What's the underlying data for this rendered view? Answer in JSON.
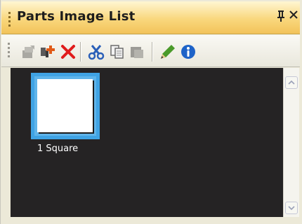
{
  "panel": {
    "title": "Parts Image List",
    "pin_glyph": "q",
    "close_glyph": "×"
  },
  "toolbar": {
    "buttons": [
      {
        "name": "import-image-icon",
        "enabled": false
      },
      {
        "name": "add-part-icon",
        "enabled": true
      },
      {
        "name": "delete-icon",
        "enabled": true
      },
      {
        "name": "cut-icon",
        "enabled": true
      },
      {
        "name": "copy-icon",
        "enabled": true
      },
      {
        "name": "paste-icon",
        "enabled": false
      },
      {
        "name": "edit-pencil-icon",
        "enabled": true
      },
      {
        "name": "info-icon",
        "enabled": true
      }
    ]
  },
  "list": {
    "items": [
      {
        "label": "1 Square",
        "selected": true
      }
    ]
  },
  "colors": {
    "title_bar_top": "#fff6d2",
    "title_bar_bottom": "#f2c35a",
    "list_background": "#252324",
    "selection": "#3fa3e4",
    "delete_red": "#e01c1c",
    "cut_blue": "#2a5fb8",
    "pencil_green": "#4a9a2a",
    "info_blue": "#1e63c8"
  }
}
